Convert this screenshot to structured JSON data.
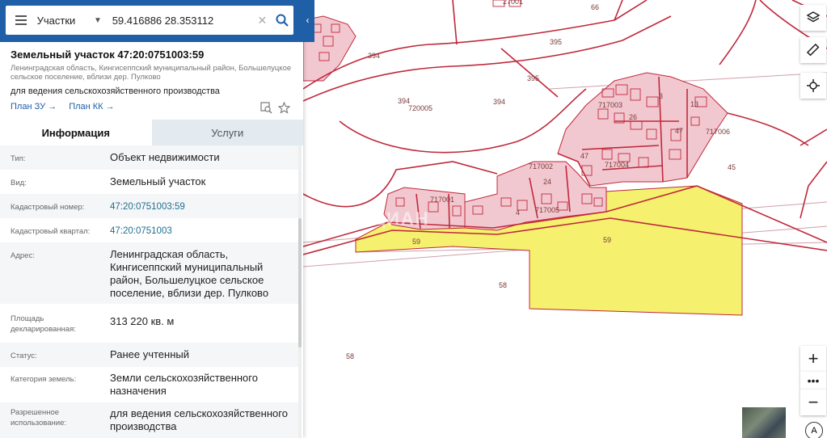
{
  "search": {
    "type_label": "Участки",
    "query": "59.416886 28.353112"
  },
  "parcel": {
    "title": "Земельный участок 47:20:0751003:59",
    "address_small": "Ленинградская область, Кингисеппский муниципальный район, Большелуцкое сельское поселение, вблизи дер. Пулково",
    "purpose": "для ведения сельскохозяйственного производства",
    "link_zu": "План ЗУ →",
    "link_kk": "План КК →"
  },
  "tabs": {
    "info": "Информация",
    "services": "Услуги"
  },
  "info_rows": [
    {
      "label": "Тип:",
      "value": "Объект недвижимости"
    },
    {
      "label": "Вид:",
      "value": "Земельный участок"
    },
    {
      "label": "Кадастровый номер:",
      "value": "47:20:0751003:59"
    },
    {
      "label": "Кадастровый квартал:",
      "value": "47:20:0751003"
    },
    {
      "label": "Адрес:",
      "value": "Ленинградская область, Кингисеппский муниципальный район, Большелуцкое сельское поселение, вблизи дер. Пулково"
    },
    {
      "label": "Площадь декларированная:",
      "value": "313 220 кв. м"
    },
    {
      "label": "Статус:",
      "value": "Ранее учтенный"
    },
    {
      "label": "Категория земель:",
      "value": "Земли сельскохозяйственного назначения"
    },
    {
      "label": "Разрешенное использование:",
      "value": "для ведения сельскохозяйственного производства"
    }
  ],
  "map": {
    "labels": [
      "394",
      "395",
      "395",
      "394",
      "720005",
      "394",
      "717003",
      "717006",
      "45",
      "717002",
      "717004",
      "717001",
      "717005",
      "59",
      "59",
      "58",
      "58",
      "27001",
      "66",
      "3",
      "13",
      "47",
      "26",
      "24",
      "4",
      "47"
    ],
    "highlight_color": "#f5f06e",
    "boundary_color": "#c0283c",
    "built_fill": "#f2c8d0"
  },
  "controls": {
    "zoom_in": "+",
    "zoom_dots": "•••",
    "zoom_out": "−",
    "compass": "A"
  },
  "watermark": "ЦИАН"
}
